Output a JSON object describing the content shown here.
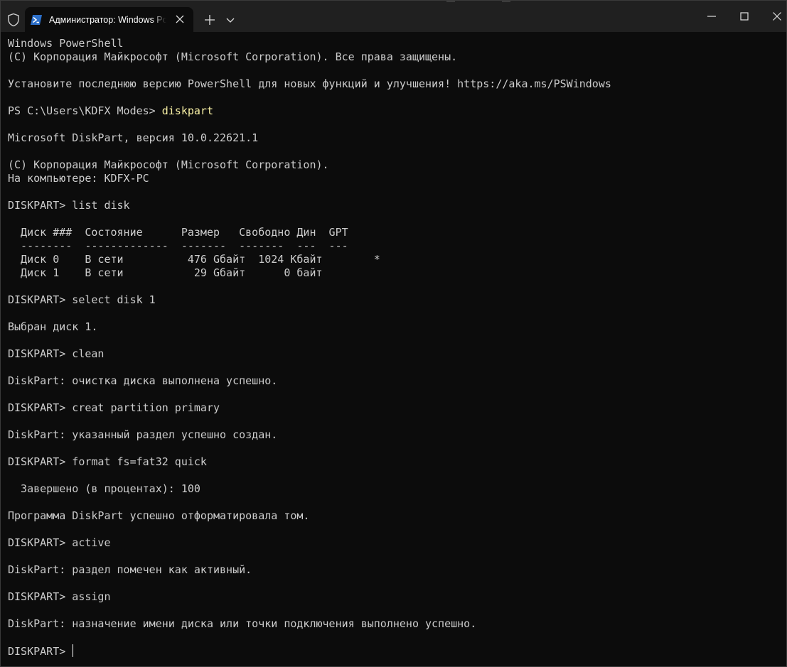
{
  "window": {
    "tab_title": "Администратор: Windows PowerShell",
    "icons": {
      "shield": "shield-icon",
      "tab": "powershell-icon",
      "tab_close": "close-icon",
      "new_tab": "plus-icon",
      "dropdown": "chevron-down-icon",
      "minimize": "minimize-icon",
      "maximize": "maximize-icon",
      "close": "close-icon"
    },
    "colors": {
      "titlebar": "#202020",
      "background": "#0c0c0c",
      "text": "#cccccc",
      "command": "#f9f1a5"
    }
  },
  "terminal": {
    "lines": [
      {
        "text": "Windows PowerShell"
      },
      {
        "text": "(C) Корпорация Майкрософт (Microsoft Corporation). Все права защищены."
      },
      {
        "text": ""
      },
      {
        "text": "Установите последнюю версию PowerShell для новых функций и улучшения! https://aka.ms/PSWindows"
      },
      {
        "text": ""
      },
      {
        "prefix": "PS C:\\Users\\KDFX Modes> ",
        "command": "diskpart"
      },
      {
        "text": ""
      },
      {
        "text": "Microsoft DiskPart, версия 10.0.22621.1"
      },
      {
        "text": ""
      },
      {
        "text": "(C) Корпорация Майкрософт (Microsoft Corporation)."
      },
      {
        "text": "На компьютере: KDFX-PC"
      },
      {
        "text": ""
      },
      {
        "text": "DISKPART> list disk"
      },
      {
        "text": ""
      },
      {
        "text": "  Диск ###  Состояние      Размер   Свободно Дин  GPT"
      },
      {
        "text": "  --------  -------------  -------  -------  ---  ---"
      },
      {
        "text": "  Диск 0    В сети          476 Gбайт  1024 Кбайт        *"
      },
      {
        "text": "  Диск 1    В сети           29 Gбайт      0 байт"
      },
      {
        "text": ""
      },
      {
        "text": "DISKPART> select disk 1"
      },
      {
        "text": ""
      },
      {
        "text": "Выбран диск 1."
      },
      {
        "text": ""
      },
      {
        "text": "DISKPART> clean"
      },
      {
        "text": ""
      },
      {
        "text": "DiskPart: очистка диска выполнена успешно."
      },
      {
        "text": ""
      },
      {
        "text": "DISKPART> creat partition primary"
      },
      {
        "text": ""
      },
      {
        "text": "DiskPart: указанный раздел успешно создан."
      },
      {
        "text": ""
      },
      {
        "text": "DISKPART> format fs=fat32 quick"
      },
      {
        "text": ""
      },
      {
        "text": "  Завершено (в процентах): 100"
      },
      {
        "text": ""
      },
      {
        "text": "Программа DiskPart успешно отформатировала том."
      },
      {
        "text": ""
      },
      {
        "text": "DISKPART> active"
      },
      {
        "text": ""
      },
      {
        "text": "DiskPart: раздел помечен как активный."
      },
      {
        "text": ""
      },
      {
        "text": "DISKPART> assign"
      },
      {
        "text": ""
      },
      {
        "text": "DiskPart: назначение имени диска или точки подключения выполнено успешно."
      },
      {
        "text": ""
      },
      {
        "prefix": "DISKPART> ",
        "cursor": true
      }
    ]
  }
}
